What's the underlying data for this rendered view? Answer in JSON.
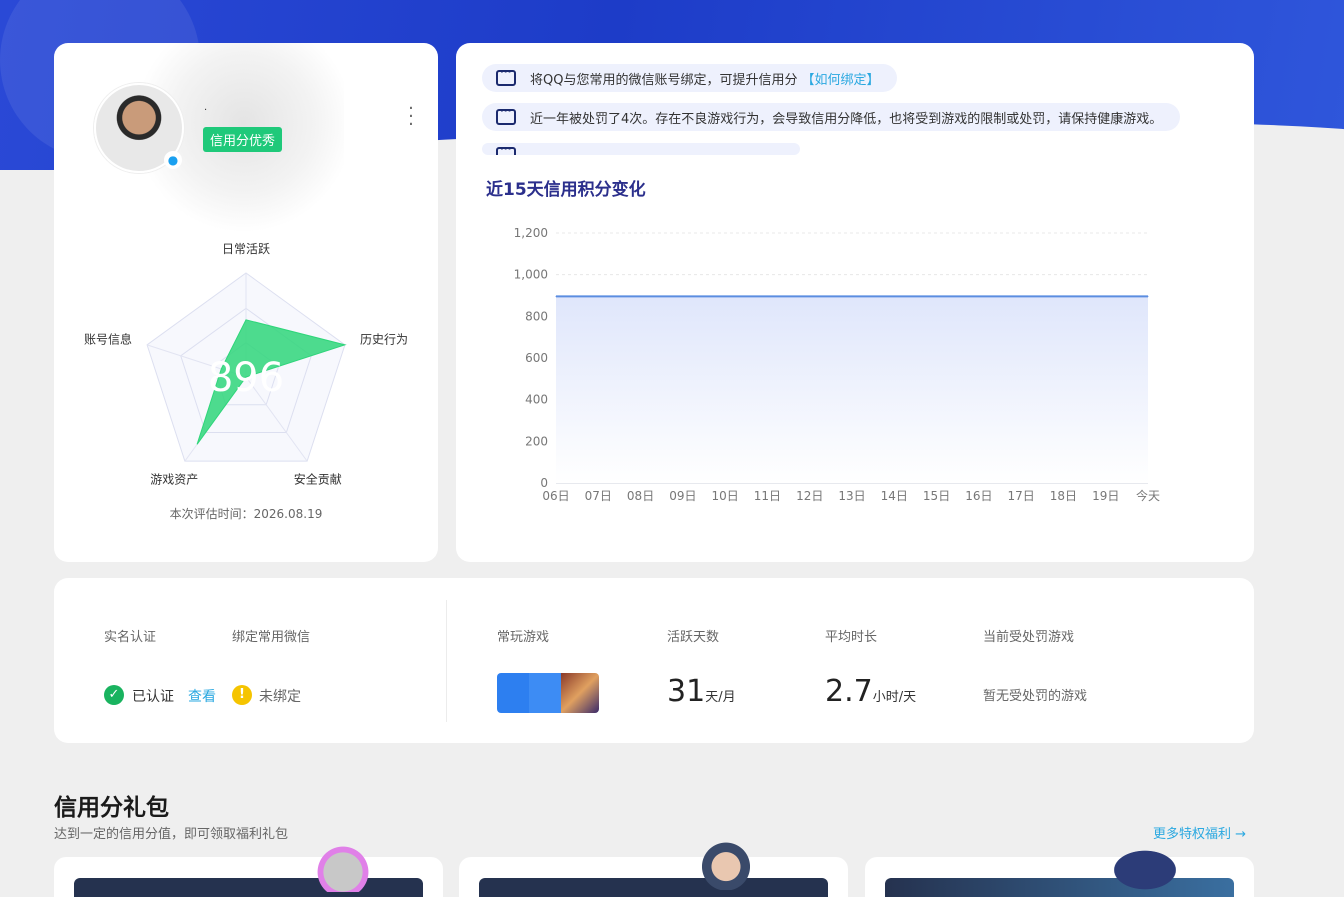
{
  "profile": {
    "nickname": "·",
    "tag": "信用分优秀",
    "score": "896",
    "eval_time": "本次评估时间：2026.08.19",
    "radar_axes": [
      "日常活跃",
      "历史行为",
      "安全贡献",
      "游戏资产",
      "账号信息"
    ],
    "radar_values": [
      0.55,
      1.0,
      0.0,
      0.8,
      0.25
    ],
    "colors": {
      "radar_fill": "#2fd67a",
      "tag": "#1fc97a"
    }
  },
  "notices": [
    {
      "text": "将QQ与您常用的微信账号绑定，可提升信用分",
      "link": "【如何绑定】"
    },
    {
      "text": "近一年被处罚了4次。存在不良游戏行为，会导致信用分降低，也将受到游戏的限制或处罚，请保持健康游戏。",
      "link": ""
    },
    {
      "text": "",
      "link": ""
    }
  ],
  "chart_title": "近15天信用积分变化",
  "chart_data": {
    "type": "area",
    "title": "近15天信用积分变化",
    "x": [
      "06日",
      "07日",
      "08日",
      "09日",
      "10日",
      "11日",
      "12日",
      "13日",
      "14日",
      "15日",
      "16日",
      "17日",
      "18日",
      "19日",
      "今天"
    ],
    "y": [
      896,
      896,
      896,
      896,
      896,
      896,
      896,
      896,
      896,
      896,
      896,
      896,
      896,
      896,
      896
    ],
    "ylim": [
      0,
      1200
    ],
    "yticks": [
      "0",
      "200",
      "400",
      "600",
      "800",
      "1,000",
      "1,200"
    ],
    "grid": true,
    "colors": {
      "line": "#5b8de0",
      "fill": "#dfe6fb"
    }
  },
  "stats": {
    "realname_label": "实名认证",
    "realname_value": "已认证",
    "realname_link": "查看",
    "wechat_label": "绑定常用微信",
    "wechat_value": "未绑定",
    "games_label": "常玩游戏",
    "active_label": "活跃天数",
    "active_value": "31",
    "active_unit": "天/月",
    "avg_label": "平均时长",
    "avg_value": "2.7",
    "avg_unit": "小时/天",
    "punish_label": "当前受处罚游戏",
    "punish_value": "暂无受处罚的游戏"
  },
  "gift": {
    "title": "信用分礼包",
    "subtitle": "达到一定的信用分值，即可领取福利礼包",
    "more": "更多特权福利 →"
  }
}
